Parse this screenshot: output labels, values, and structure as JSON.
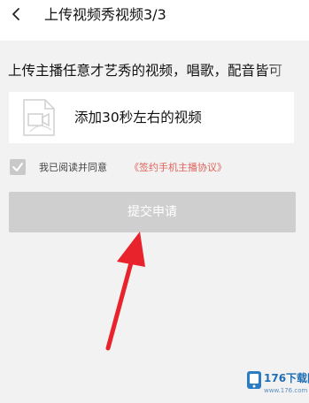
{
  "header": {
    "title": "上传视频秀视频3/3"
  },
  "intro_text": "上传主播任意才艺秀的视频，唱歌，配音皆可",
  "upload": {
    "label": "添加30秒左右的视频"
  },
  "agreement": {
    "checked": true,
    "text": "我已阅读并同意",
    "link": "《签约手机主播协议》"
  },
  "submit_label": "提交申请",
  "watermark": {
    "text": "176下载网",
    "sub": "www.176.com"
  },
  "colors": {
    "background": "#f2f2f2",
    "button_disabled": "#cfcfcf",
    "link": "#e0635b",
    "arrow": "#e8232b"
  }
}
